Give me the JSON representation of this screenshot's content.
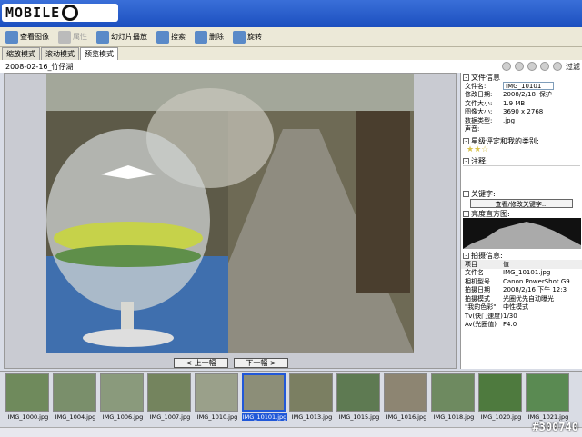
{
  "logo": {
    "text": "MOBILE"
  },
  "toolbar": {
    "items": [
      {
        "label": "查看图像",
        "icon": "view-image-icon",
        "disabled": false
      },
      {
        "label": "属性",
        "icon": "properties-icon",
        "disabled": true
      },
      {
        "label": "幻灯片播放",
        "icon": "slideshow-icon",
        "disabled": false
      },
      {
        "label": "搜索",
        "icon": "search-icon",
        "disabled": false
      },
      {
        "label": "删除",
        "icon": "delete-icon",
        "disabled": false
      },
      {
        "label": "旋转",
        "icon": "rotate-icon",
        "disabled": false
      }
    ]
  },
  "tabs": [
    {
      "label": "缩放模式",
      "active": false
    },
    {
      "label": "滚动模式",
      "active": false
    },
    {
      "label": "预览模式",
      "active": true
    }
  ],
  "subbar": {
    "path": "2008-02-16_竹仔湖",
    "filter_label": "过滤"
  },
  "nav": {
    "prev": "< 上一幅",
    "next": "下一幅 >"
  },
  "info": {
    "header": "文件信息",
    "rows": [
      {
        "k": "文件名:",
        "v": "IMG_10101"
      },
      {
        "k": "修改日期:",
        "v": "2008/2/18"
      },
      {
        "k": "文件大小:",
        "v": "1.9 MB"
      },
      {
        "k": "图像大小:",
        "v": "3690 x 2768"
      },
      {
        "k": "数据类型:",
        "v": ".jpg"
      },
      {
        "k": "声音:",
        "v": ""
      }
    ],
    "protect_label": "保护",
    "rating_header": "星级评定和我的类别:",
    "comment_header": "注释:",
    "keyword_header": "关键字:",
    "keyword_button": "查看/修改关键字...",
    "histogram_header": "亮度直方图:",
    "shoot_header": "拍摄信息:",
    "shoot_cols": [
      "项目",
      "值"
    ],
    "shoot_rows": [
      {
        "k": "文件名",
        "v": "IMG_10101.jpg"
      },
      {
        "k": "相机型号",
        "v": "Canon PowerShot G9"
      },
      {
        "k": "拍摄日期",
        "v": "2008/2/16 下午 12:3"
      },
      {
        "k": "拍摄模式",
        "v": "光圈优先自动曝光"
      },
      {
        "k": "\"我的色彩\"",
        "v": "中性模式"
      },
      {
        "k": "Tv(快门速度)",
        "v": "1/30"
      },
      {
        "k": "Av(光圈值)",
        "v": "F4.0"
      }
    ]
  },
  "thumbnails": [
    {
      "label": "IMG_1000.jpg",
      "color": "#6f8a5c"
    },
    {
      "label": "IMG_1004.jpg",
      "color": "#7a8f6b"
    },
    {
      "label": "IMG_1006.jpg",
      "color": "#8a9a7c"
    },
    {
      "label": "IMG_1007.jpg",
      "color": "#74845e"
    },
    {
      "label": "IMG_1010.jpg",
      "color": "#9aa08a"
    },
    {
      "label": "IMG_10101.jpg",
      "color": "#8c8e78",
      "selected": true
    },
    {
      "label": "IMG_1013.jpg",
      "color": "#7b7f62"
    },
    {
      "label": "IMG_1015.jpg",
      "color": "#5e7a52"
    },
    {
      "label": "IMG_1016.jpg",
      "color": "#8d8572"
    },
    {
      "label": "IMG_1018.jpg",
      "color": "#6e8a60"
    },
    {
      "label": "IMG_1020.jpg",
      "color": "#4e7a3e"
    },
    {
      "label": "IMG_1021.jpg",
      "color": "#5a8a52"
    }
  ],
  "watermark": "#300740"
}
